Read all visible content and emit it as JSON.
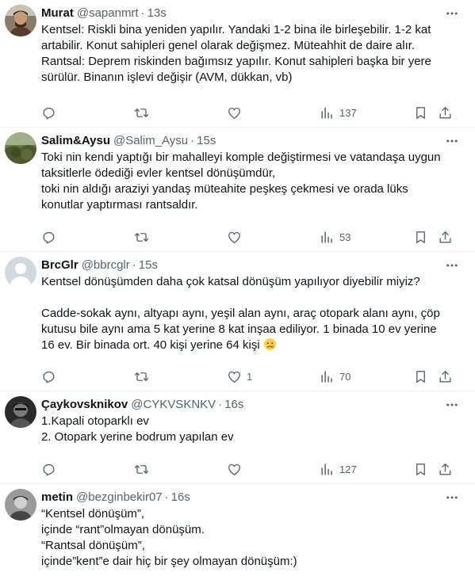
{
  "tweets": [
    {
      "name": "Murat",
      "handle": "@sapanmrt",
      "time": "13s",
      "lines": [
        "Kentsel: Riskli bina yeniden yapılır. Yandaki 1-2 bina ile birleşebilir. 1-2 kat",
        "artabilir. Konut sahipleri genel olarak değişmez. Müteahhit de daire alır.",
        "Rantsal: Deprem riskinden bağımsız yapılır. Konut sahipleri başka bir yere",
        "sürülür. Binanın işlevi değişir (AVM, dükkan, vb)"
      ],
      "reply_count": "",
      "retweet_count": "",
      "like_count": "",
      "views": "137"
    },
    {
      "name": "Salim&Aysu",
      "handle": "@Salim_Aysu",
      "time": "15s",
      "lines": [
        "Toki nin kendi yaptığı bir mahalleyi komple değiştirmesi ve vatandaşa uygun",
        "taksitlerle ödediği evler kentsel dönüşümdür,",
        "toki nin aldığı araziyi yandaş müteahite peşkeş çekmesi ve orada lüks",
        "konutlar yaptırması rantsaldır."
      ],
      "reply_count": "",
      "retweet_count": "",
      "like_count": "",
      "views": "53"
    },
    {
      "name": "BrcGlr",
      "handle": "@bbrcglr",
      "time": "15s",
      "lines": [
        "Kentsel dönüşümden daha çok katsal dönüşüm yapılıyor diyebilir miyiz?",
        "",
        "Cadde-sokak aynı, altyapı aynı, yeşil alan aynı, araç otopark alanı aynı, çöp",
        "kutusu bile aynı ama 5 kat yerine 8 kat inşaa ediliyor. 1 binada 10 ev yerine",
        "16 ev. Bir binada ort. 40 kişi yerine 64 kişi"
      ],
      "reply_count": "",
      "retweet_count": "",
      "like_count": "1",
      "views": "70"
    },
    {
      "name": "Çaykovsknikov",
      "handle": "@CYKVSKNKV",
      "time": "16s",
      "lines": [
        "1.Kapali otoparklı ev",
        "2. Otopark yerine bodrum yapılan ev"
      ],
      "reply_count": "",
      "retweet_count": "",
      "like_count": "",
      "views": "127"
    },
    {
      "name": "metin",
      "handle": "@bezginbekir07",
      "time": "16s",
      "lines": [
        "“Kentsel dönüşüm”,",
        "içinde “rant”olmayan dönüşüm.",
        "“Rantsal dönüşüm”,",
        "içinde”kent”e dair hiç bir şey olmayan dönüşüm:)"
      ],
      "reply_count": "",
      "retweet_count": "",
      "like_count": "",
      "views": ""
    }
  ],
  "separator": "·",
  "icons": {
    "more": "more-icon",
    "reply": "reply-icon",
    "retweet": "retweet-icon",
    "like": "like-icon",
    "views": "views-icon",
    "bookmark": "bookmark-icon",
    "share": "share-icon",
    "emoji": "sad-face-emoji"
  },
  "colors": {
    "text": "#0f1419",
    "secondary": "#536471",
    "divider": "#eff3f4"
  }
}
